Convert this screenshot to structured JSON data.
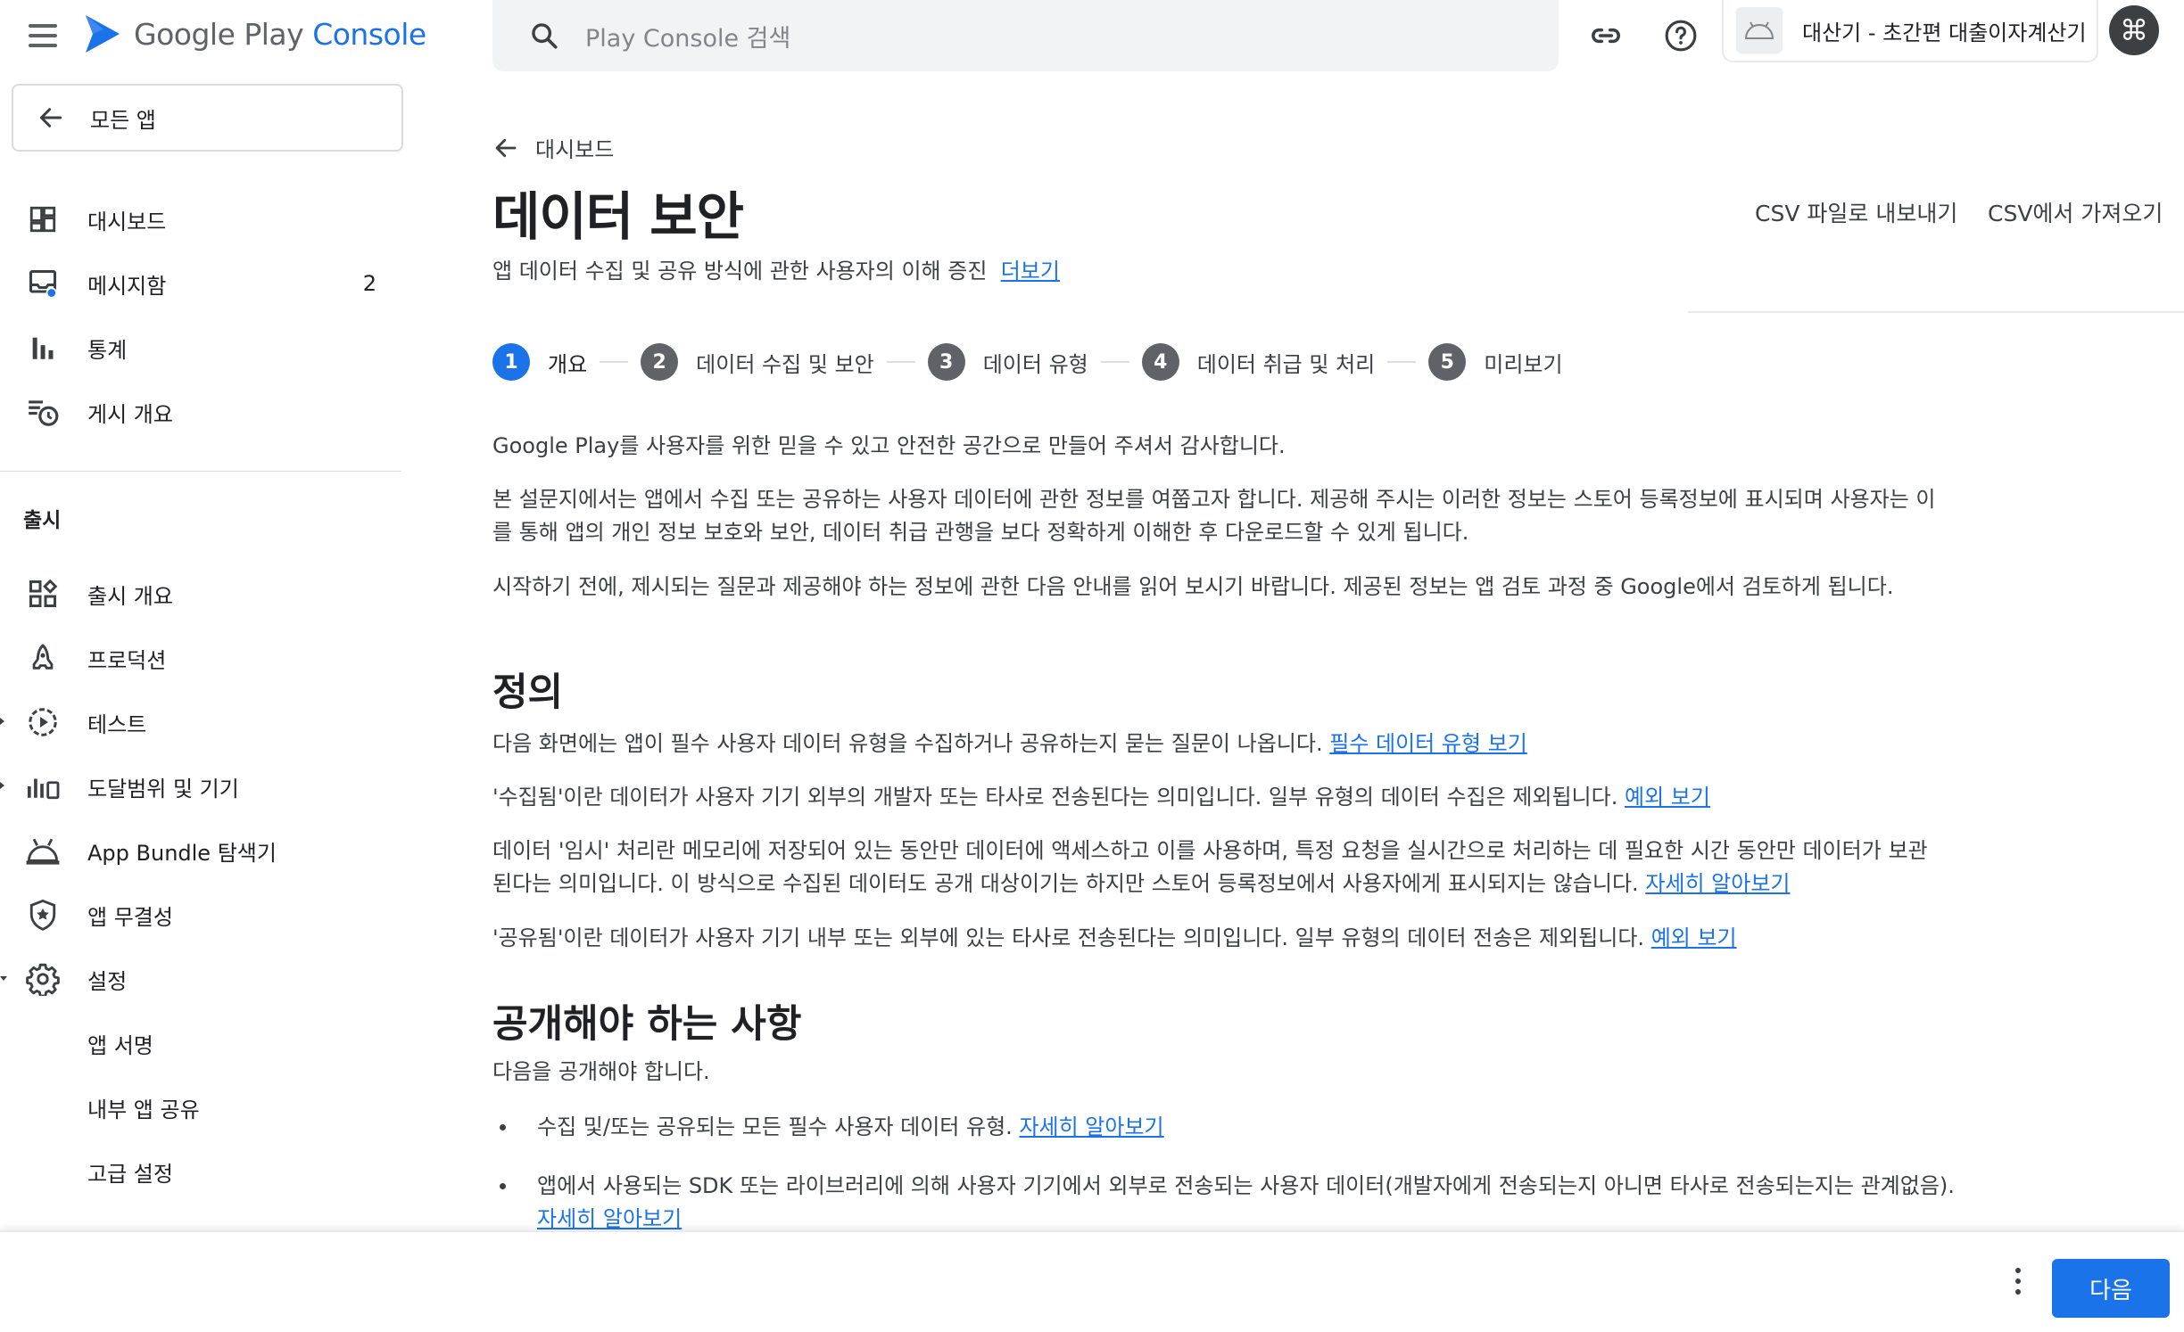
{
  "header": {
    "logo_prefix": "Google Play",
    "logo_suffix": "Console",
    "search_placeholder": "Play Console 검색",
    "app_name": "대산기 - 초간편 대출이자계산기"
  },
  "sidebar": {
    "all_apps": "모든 앱",
    "items": [
      {
        "label": "대시보드"
      },
      {
        "label": "메시지함",
        "badge": "2"
      },
      {
        "label": "통계"
      },
      {
        "label": "게시 개요"
      }
    ],
    "section": "출시",
    "release_items": [
      {
        "label": "출시 개요"
      },
      {
        "label": "프로덕션"
      },
      {
        "label": "테스트"
      },
      {
        "label": "도달범위 및 기기"
      },
      {
        "label": "App Bundle 탐색기"
      },
      {
        "label": "앱 무결성"
      },
      {
        "label": "설정"
      },
      {
        "label": "앱 서명"
      },
      {
        "label": "내부 앱 공유"
      },
      {
        "label": "고급 설정"
      }
    ]
  },
  "main": {
    "breadcrumb": "대시보드",
    "title": "데이터 보안",
    "subtitle": "앱 데이터 수집 및 공유 방식에 관한 사용자의 이해 증진",
    "subtitle_link": "더보기",
    "export_csv": "CSV 파일로 내보내기",
    "import_csv": "CSV에서 가져오기",
    "steps": [
      {
        "num": "1",
        "label": "개요"
      },
      {
        "num": "2",
        "label": "데이터 수집 및 보안"
      },
      {
        "num": "3",
        "label": "데이터 유형"
      },
      {
        "num": "4",
        "label": "데이터 취급 및 처리"
      },
      {
        "num": "5",
        "label": "미리보기"
      }
    ],
    "intro_p1": "Google Play를 사용자를 위한 믿을 수 있고 안전한 공간으로 만들어 주셔서 감사합니다.",
    "intro_p2": "본 설문지에서는 앱에서 수집 또는 공유하는 사용자 데이터에 관한 정보를 여쭙고자 합니다. 제공해 주시는 이러한 정보는 스토어 등록정보에 표시되며 사용자는 이를 통해 앱의 개인 정보 보호와 보안, 데이터 취급 관행을 보다 정확하게 이해한 후 다운로드할 수 있게 됩니다.",
    "intro_p3": "시작하기 전에, 제시되는 질문과 제공해야 하는 정보에 관한 다음 안내를 읽어 보시기 바랍니다. 제공된 정보는 앱 검토 과정 중 Google에서 검토하게 됩니다.",
    "definitions_title": "정의",
    "def_p1": "다음 화면에는 앱이 필수 사용자 데이터 유형을 수집하거나 공유하는지 묻는 질문이 나옵니다.",
    "def_p1_link": "필수 데이터 유형 보기",
    "def_p2": "'수집됨'이란 데이터가 사용자 기기 외부의 개발자 또는 타사로 전송된다는 의미입니다. 일부 유형의 데이터 수집은 제외됩니다.",
    "def_p2_link": "예외 보기",
    "def_p3": "데이터 '임시' 처리란 메모리에 저장되어 있는 동안만 데이터에 액세스하고 이를 사용하며, 특정 요청을 실시간으로 처리하는 데 필요한 시간 동안만 데이터가 보관된다는 의미입니다. 이 방식으로 수집된 데이터도 공개 대상이기는 하지만 스토어 등록정보에서 사용자에게 표시되지는 않습니다.",
    "def_p3_link": "자세히 알아보기",
    "def_p4": "'공유됨'이란 데이터가 사용자 기기 내부 또는 외부에 있는 타사로 전송된다는 의미입니다. 일부 유형의 데이터 전송은 제외됩니다.",
    "def_p4_link": "예외 보기",
    "disclose_title": "공개해야 하는 사항",
    "disclose_intro": "다음을 공개해야 합니다.",
    "bullet1": "수집 및/또는 공유되는 모든 필수 사용자 데이터 유형.",
    "bullet1_link": "자세히 알아보기",
    "bullet2": "앱에서 사용되는 SDK 또는 라이브러리에 의해 사용자 기기에서 외부로 전송되는 사용자 데이터(개발자에게 전송되는지 아니면 타사로 전송되는지는 관계없음).",
    "bullet2_link": "자세히 알아보기"
  },
  "footer": {
    "next": "다음"
  }
}
